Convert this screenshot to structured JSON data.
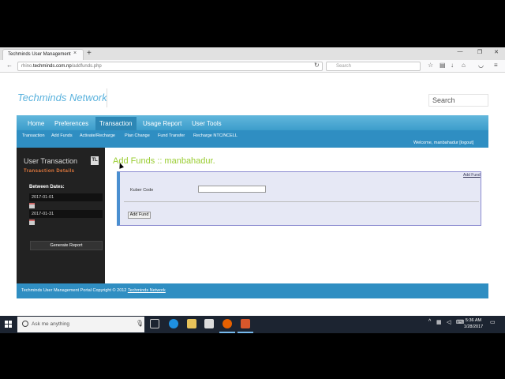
{
  "browser": {
    "tab_title": "Techminds User Management",
    "tab_close": "×",
    "new_tab": "+",
    "url_prefix": "rhino.",
    "url_domain": "techminds.com.np",
    "url_path": "/addfunds.php",
    "search_placeholder": "Search",
    "icons": [
      "back-icon",
      "info-icon",
      "reload-icon",
      "bookmark-star-icon",
      "reading-list-icon",
      "download-icon",
      "home-icon",
      "pocket-icon",
      "menu-icon"
    ]
  },
  "site": {
    "brand": "Techminds Network",
    "search_value": "Search",
    "nav": [
      "Home",
      "Preferences",
      "Transaction",
      "Usage Report",
      "User Tools"
    ],
    "subnav": [
      "Transaction",
      "Add Funds",
      "Activate/Recharge",
      "Plan Change",
      "Fund Transfer",
      "Recharge NTC/NCELL"
    ],
    "welcome": "Welcome, manbahadur [logout]"
  },
  "sidebar": {
    "title": "User Transaction",
    "badge": "TL",
    "subtitle": "Transaction Details",
    "between_label": "Between Dates:",
    "date_from": "2017-01-01",
    "date_to": "2017-01-31",
    "generate_label": "Generate Report"
  },
  "content": {
    "title": "Add Funds :: manbahadur.",
    "corner_link": "Add Fund",
    "kuber_label": "Kuber Code",
    "kuber_value": "",
    "submit_label": "Add Fund"
  },
  "footer": {
    "text": "Techminds User Management Portal Copyright © 2012",
    "link": "Techminds Network"
  },
  "taskbar": {
    "search_placeholder": "Ask me anything",
    "time": "5:36 AM",
    "date": "1/28/2017"
  },
  "colors": {
    "nav_blue": "#3c9dcb",
    "title_green": "#9acd32",
    "sidebar_dark": "#222222",
    "accent_orange": "#e57a3e"
  }
}
